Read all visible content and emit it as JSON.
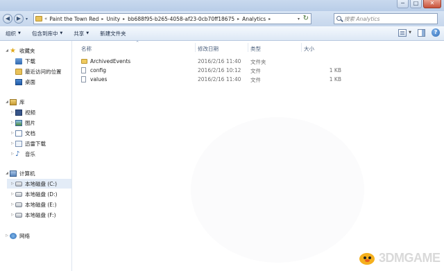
{
  "window": {
    "controls": {
      "minimize": "─",
      "maximize": "□",
      "close": "✕"
    }
  },
  "address_bar": {
    "lead": "«",
    "crumbs": [
      "Paint the Town Red",
      "Unity",
      "bb688f95-b265-4058-af23-0cb70ff18675",
      "Analytics"
    ],
    "separator": "▸",
    "dropdown": "▾",
    "refresh": "↻"
  },
  "search": {
    "placeholder": "搜索 Analytics"
  },
  "nav_buttons": {
    "back": "◀",
    "forward": "▶",
    "dropdown": "▾"
  },
  "toolbar": {
    "organize": "组织",
    "include_in_library": "包含到库中",
    "share": "共享",
    "new_folder": "新建文件夹",
    "dropdown_arrow": "▼",
    "help": "?"
  },
  "sidebar": {
    "favorites": {
      "label": "收藏夹",
      "items": [
        "下载",
        "最近访问的位置",
        "桌面"
      ]
    },
    "libraries": {
      "label": "库",
      "items": [
        "视频",
        "图片",
        "文档",
        "迅雷下载",
        "音乐"
      ]
    },
    "computer": {
      "label": "计算机",
      "drives": [
        "本地磁盘 (C:)",
        "本地磁盘 (D:)",
        "本地磁盘 (E:)",
        "本地磁盘 (F:)"
      ]
    },
    "network": {
      "label": "网络"
    },
    "expanded_arrow": "◢",
    "collapsed_arrow": "▷"
  },
  "file_list": {
    "columns": {
      "name": "名称",
      "date": "修改日期",
      "type": "类型",
      "size": "大小"
    },
    "sort_indicator": "^",
    "rows": [
      {
        "name": "ArchivedEvents",
        "date": "2016/2/16 11:40",
        "type": "文件夹",
        "size": "",
        "kind": "folder"
      },
      {
        "name": "config",
        "date": "2016/2/16 10:12",
        "type": "文件",
        "size": "1 KB",
        "kind": "file"
      },
      {
        "name": "values",
        "date": "2016/2/16 11:40",
        "type": "文件",
        "size": "1 KB",
        "kind": "file"
      }
    ]
  },
  "watermark": {
    "text": "3DMGAME",
    "accent": "#f5b01e"
  },
  "colors": {
    "chrome": "#c6d6ec",
    "selection": "#e3ecf7",
    "folder": "#efca5f"
  }
}
